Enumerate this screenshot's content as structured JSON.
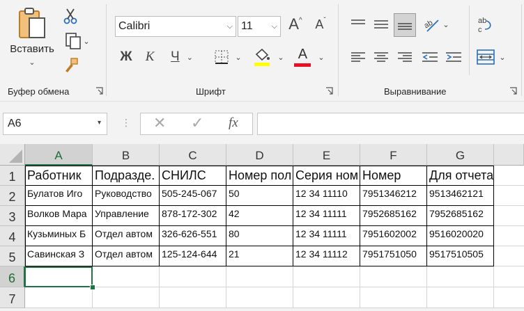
{
  "clipboard": {
    "paste_label": "Вставить",
    "group_label": "Буфер обмена"
  },
  "font": {
    "name": "Calibri",
    "size": "11",
    "grow": "A",
    "shrink": "A",
    "bold": "Ж",
    "italic": "К",
    "underline": "Ч",
    "font_color_letter": "A",
    "group_label": "Шрифт"
  },
  "alignment": {
    "group_label": "Выравнивание",
    "wrap_icon_text": "ab c"
  },
  "colors": {
    "accent": "#217346",
    "highlight": "#ffff00",
    "font_red": "#e81123",
    "grid_border": "#000000"
  },
  "formula_bar": {
    "name_box": "A6",
    "fx": "fx",
    "formula": ""
  },
  "columns": [
    "A",
    "B",
    "C",
    "D",
    "E",
    "F",
    "G"
  ],
  "rows": [
    "1",
    "2",
    "3",
    "4",
    "5",
    "6",
    "7"
  ],
  "table": {
    "header": [
      "Работник",
      "Подразде.",
      "СНИЛС",
      "Номер пол",
      "Серия ном",
      "Номер",
      "Для отчета"
    ],
    "data": [
      [
        "Булатов Иго",
        "Руководство",
        "505-245-067",
        "50",
        "12 34 11110",
        "7951346212",
        "9513462121"
      ],
      [
        "Волков Мара",
        "Управление",
        "878-172-302",
        "42",
        "12 34 11111",
        "7952685162",
        "7952685162"
      ],
      [
        "Кузьминых Б",
        "Отдел автом",
        "326-626-551",
        "80",
        "12 34 11111",
        "7951602002",
        "9516020020"
      ],
      [
        "Савинская З",
        "Отдел автом",
        "125-124-644",
        "21",
        "12 34 11112",
        "7951751050",
        "9517510505"
      ]
    ]
  }
}
